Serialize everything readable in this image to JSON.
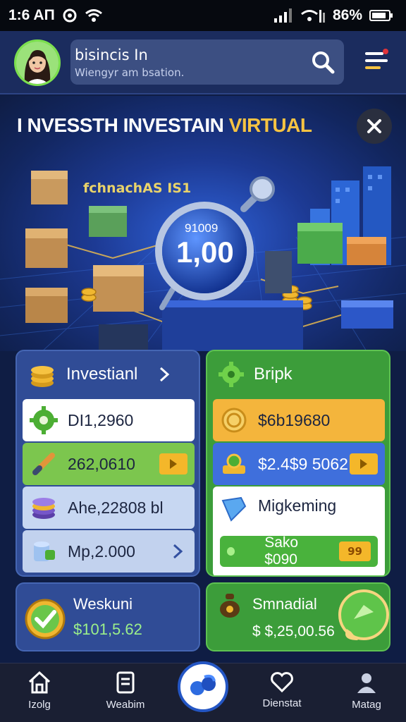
{
  "status_bar": {
    "time": "1:6 AП",
    "battery": "86%",
    "battery_level": 0.86
  },
  "header": {
    "search_title": "bisincis In",
    "search_subtitle": "Wiengyr am bsation.",
    "avatar_icon": "avatar-woman",
    "search_icon": "search-icon",
    "menu_icon": "menu-filter-icon"
  },
  "hero": {
    "title_main": "I NVESSTH INVESTAIN ",
    "title_accent": "VIRTUAL",
    "tag_text": "fchnachAS IS1",
    "coin_small": "91009",
    "coin_big": "1,00"
  },
  "colors": {
    "accent": "#f6c342",
    "blue_card": "#304c96",
    "green_card": "#3c9d3a",
    "nav_bg": "#1a1f33"
  },
  "cards": {
    "investment": {
      "title": "Investianl",
      "rows": [
        {
          "value": "DI1,2960",
          "icon": "gear-icon"
        },
        {
          "value": "262,0610",
          "icon": "pen-icon"
        },
        {
          "value": "Ahe,22808 bl",
          "icon": "coin-stack-icon"
        },
        {
          "value": "Mp,2.000",
          "icon": "cylinder-icon"
        }
      ]
    },
    "bank": {
      "title": "Bripk",
      "rows": [
        {
          "value": "$6b19680",
          "icon": "coin-icon"
        },
        {
          "value": "$2.4$9 5062",
          "icon": "medal-icon"
        },
        {
          "value": "Migkeming",
          "icon": "shield-icon"
        },
        {
          "value": "Sako $090",
          "badge": "99"
        }
      ]
    },
    "weekly": {
      "title": "Weskuni",
      "amount": "$101,5.62"
    },
    "standard": {
      "title": "Smnadial",
      "amount": "$ $,25,00.56"
    }
  },
  "bottom_nav": {
    "items": [
      {
        "label": "Izolg",
        "icon": "home-icon"
      },
      {
        "label": "Weabim",
        "icon": "document-icon"
      },
      {
        "label": "Dienstat",
        "icon": "heart-icon"
      },
      {
        "label": "Matag",
        "icon": "profile-icon"
      }
    ]
  }
}
